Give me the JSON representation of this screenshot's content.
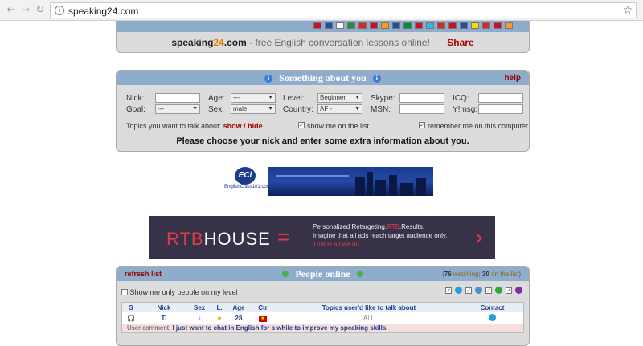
{
  "browser": {
    "url": "speaking24.com",
    "back_icon": "←",
    "forward_icon": "→",
    "reload_icon": "↻",
    "star_icon": "☆"
  },
  "header": {
    "site_name_prefix": "speaking",
    "site_name_number": "24",
    "site_name_suffix": ".com",
    "tagline": "- free English conversation lessons online!",
    "share_label": "Share",
    "flag_colors": [
      "#c8102e",
      "#1e4fa3",
      "#ffffff",
      "#1f8f3a",
      "#d52b1e",
      "#c8102e",
      "#ff9f00",
      "#1e4fa3",
      "#008c45",
      "#c8102e",
      "#3cb4e5",
      "#d52b1e",
      "#c8102e",
      "#1e4fa3",
      "#ffd700",
      "#d52b1e",
      "#c8102e",
      "#ff9933"
    ]
  },
  "about": {
    "title": "Something about you",
    "help_label": "help",
    "nick_label": "Nick:",
    "goal_label": "Goal:",
    "goal_value": "---",
    "age_label": "Age:",
    "age_value": "---",
    "sex_label": "Sex:",
    "sex_value": "male",
    "level_label": "Level:",
    "level_value": "Beginner",
    "country_label": "Country:",
    "country_value": "AF - Afghanistan",
    "skype_label": "Skype:",
    "msn_label": "MSN:",
    "icq_label": "ICQ:",
    "ymsg_label": "Y!msg:",
    "topics_label": "Topics you want to talk about:",
    "showhide_label": "show / hide",
    "show_on_list_label": "show me on the list",
    "remember_label": "remember me on this computer",
    "instruction": "Please choose your nick and enter some extra information about you."
  },
  "ads": {
    "englishclass_label": "EnglishClass101.com",
    "englishclass_logo": "ECl",
    "rtb_logo_red": "RTB",
    "rtb_logo_white": "HOUSE",
    "rtb_eq": "=",
    "rtb_line1_prefix": "Personalized Retargeting.",
    "rtb_line1_red": "RTB",
    "rtb_line1_suffix": ".Results.",
    "rtb_line2": "Imagine that all ads reach target audience only.",
    "rtb_line3": "That is all we do.",
    "rtb_chevron": "›"
  },
  "people": {
    "refresh_label": "refresh list",
    "title": "People online",
    "count_total": "76",
    "count_watching_label": "watching",
    "count_on_list": "30",
    "count_on_list_label": "on the list",
    "filter_label": "Show me only people on my level",
    "columns": [
      "S",
      "Nick",
      "Sex",
      "L.",
      "Age",
      "Ctr",
      "Topics user'd like to talk about",
      "Contact"
    ],
    "rows": [
      {
        "status_icon": "🎧",
        "nick": "Ti",
        "sex_icon": "♀",
        "level_icon": "★",
        "age": "28",
        "country": "VN",
        "topics": "ALL",
        "contact": "skype",
        "comment_label": "User comment:",
        "comment": "I just want to chat in English for a while to improve my speaking skills."
      }
    ]
  }
}
